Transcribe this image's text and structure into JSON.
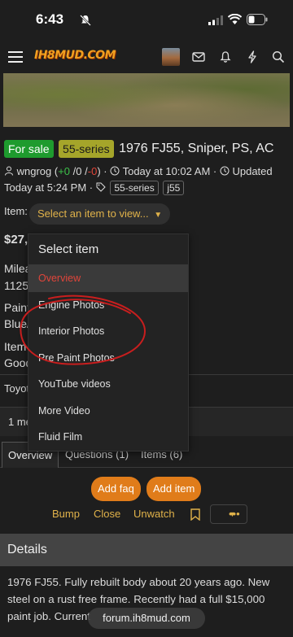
{
  "status_bar": {
    "time": "6:43"
  },
  "nav": {
    "logo_text": "IH8MUD.COM"
  },
  "thread": {
    "prefix_sale": "For sale",
    "prefix_series": "55-series",
    "title": "1976 FJ55, Sniper, PS, AC",
    "author": "wngrog",
    "rating_pos": "+0",
    "rating_neutral": "/0 /",
    "rating_neg": "-0",
    "posted": "Today at 10:02 AM",
    "updated_label": "Updated",
    "updated_time": "Today at 5:24 PM",
    "tags": [
      "55-series",
      "j55"
    ]
  },
  "item_picker": {
    "label": "Item:",
    "placeholder": "Select an item to view..."
  },
  "background": {
    "price": "$27,",
    "mileage_label": "Milea",
    "mileage_value": "1125",
    "paint_label": "Paint",
    "paint_value": "Blue/",
    "item_label": "Item",
    "item_value": "Good",
    "make": "Toyot",
    "members": "1 me"
  },
  "dropdown": {
    "header": "Select item",
    "items": [
      {
        "label": "Overview",
        "active": true
      },
      {
        "label": "Engine Photos"
      },
      {
        "label": "Interior Photos"
      },
      {
        "label": "Pre Paint Photos"
      },
      {
        "label": "YouTube videos"
      },
      {
        "label": "More Video"
      },
      {
        "label": "Fluid Film"
      }
    ]
  },
  "tabs": {
    "overview": "Overview",
    "questions": "Questions (1)",
    "items": "Items (6)"
  },
  "buttons": {
    "add_faq": "Add faq",
    "add_item": "Add item"
  },
  "actions": {
    "bump": "Bump",
    "close": "Close",
    "unwatch": "Unwatch",
    "more": "•••"
  },
  "details": {
    "header": "Details",
    "body": "1976 FJ55. Fully rebuilt body about 20 years ago. New steel on a rust free frame. Recently had a full $15,000 paint job. Current"
  },
  "url_bar": {
    "host": "forum.ih8mud.com"
  },
  "colors": {
    "accent": "#e0b24a",
    "button": "#e07c1a",
    "sale": "#1e9b2e",
    "series": "#a5a52a",
    "annotation": "#c81e1e"
  }
}
